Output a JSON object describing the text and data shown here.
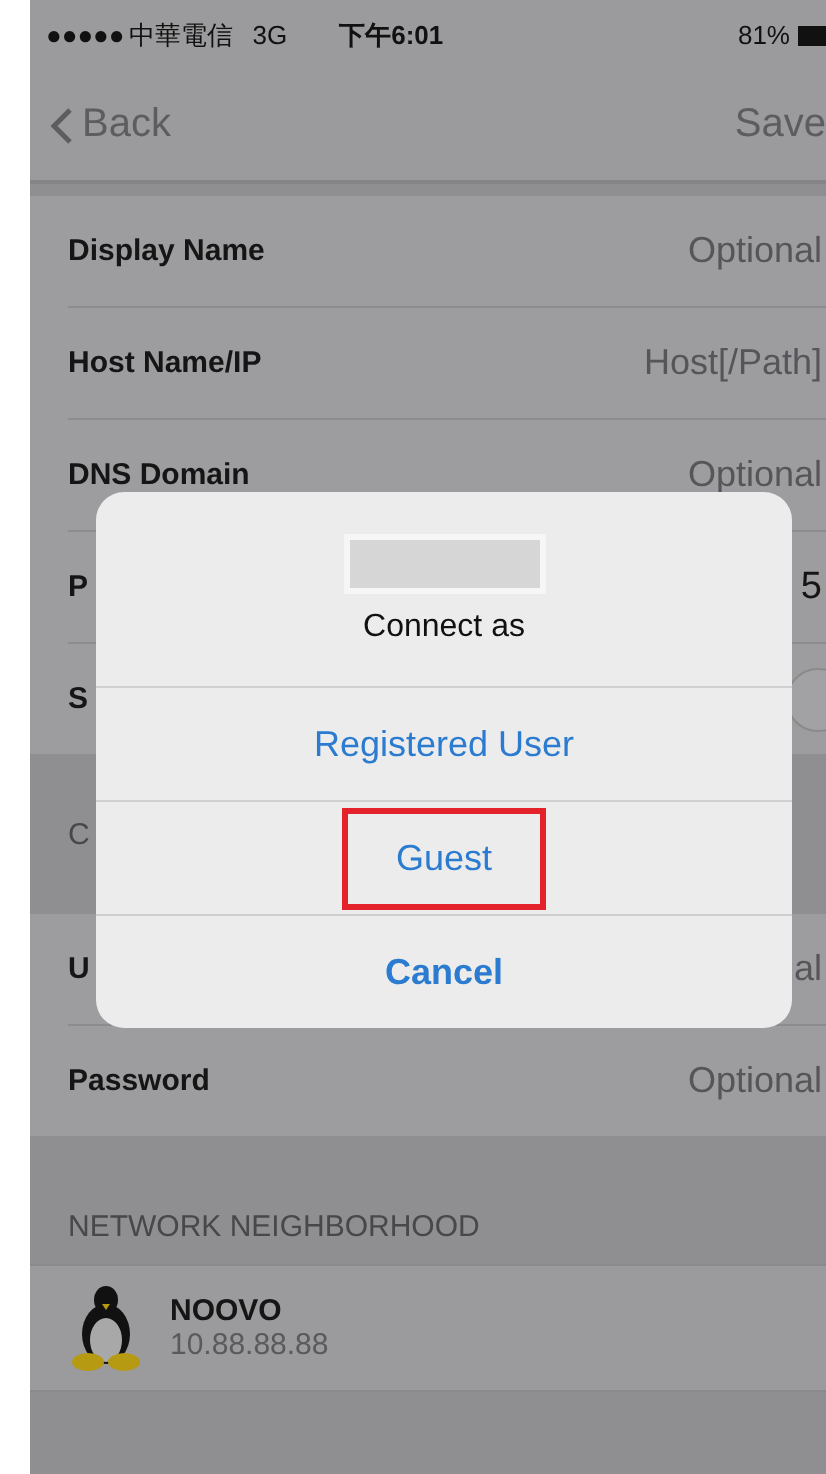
{
  "status_bar": {
    "signal": "●●●●●",
    "carrier": "中華電信",
    "network": "3G",
    "time": "下午6:01",
    "battery": "81%"
  },
  "nav": {
    "back": "Back",
    "action": "Save"
  },
  "settings_rows": [
    {
      "kind": "field",
      "label": "Display Name",
      "placeholder": "Optional"
    },
    {
      "kind": "field",
      "label": "Host Name/IP",
      "placeholder": "Host[/Path]"
    },
    {
      "kind": "field",
      "label": "DNS Domain",
      "placeholder": "Optional"
    },
    {
      "kind": "value",
      "label": "P",
      "value": "5"
    },
    {
      "kind": "toggle",
      "label": "S"
    }
  ],
  "credentials": {
    "header": "C",
    "rows": [
      {
        "kind": "field",
        "label": "U",
        "placeholder": "al"
      },
      {
        "kind": "field",
        "label": "Password",
        "placeholder": "Optional"
      }
    ]
  },
  "network_neighborhood": {
    "header": "NETWORK NEIGHBORHOOD",
    "hosts": [
      {
        "name": "NOOVO",
        "address": "10.88.88.88"
      }
    ]
  },
  "alert": {
    "message": "Connect as",
    "actions": [
      {
        "label": "Registered User",
        "kind": "default",
        "highlighted": false
      },
      {
        "label": "Guest",
        "kind": "default",
        "highlighted": true
      },
      {
        "label": "Cancel",
        "kind": "cancel",
        "highlighted": false
      }
    ]
  }
}
